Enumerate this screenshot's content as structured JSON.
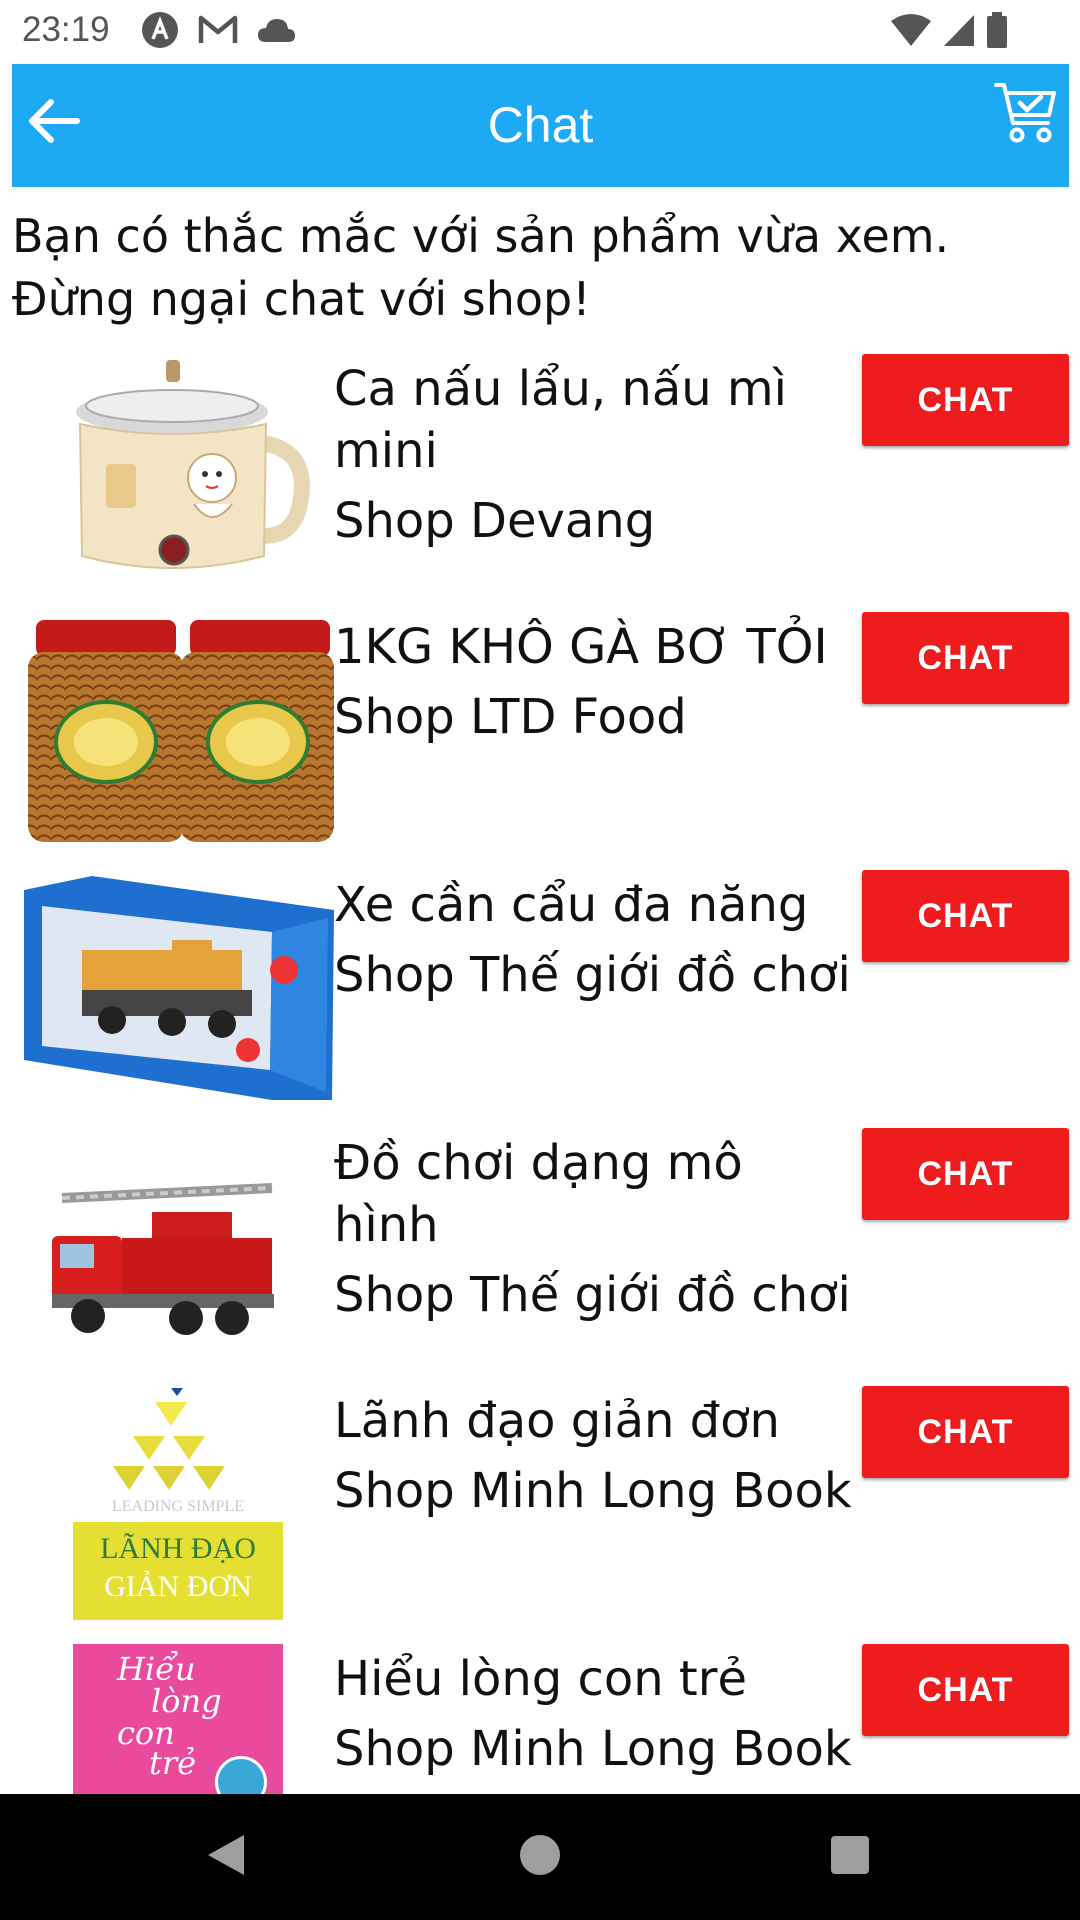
{
  "status_bar": {
    "time": "23:19",
    "left_icons": [
      "app-a-icon",
      "gmail-icon",
      "cloud-icon"
    ],
    "right_icons": [
      "wifi-icon",
      "cell-signal-icon",
      "battery-icon"
    ]
  },
  "app_bar": {
    "title": "Chat",
    "back_icon": "arrow-left-icon",
    "cart_icon": "shopping-cart-check-icon",
    "color": "#1ea9f5"
  },
  "intro": {
    "line1": "Bạn có thắc mắc với sản phẩm vừa xem.",
    "line2": "Đừng ngại chat với shop!"
  },
  "items": [
    {
      "name": "Ca nấu lẩu, nấu mì mini",
      "shop": "Shop Devang",
      "chat_label": "CHAT",
      "image": "mini-cooker-pot-image"
    },
    {
      "name": "1KG KHÔ GÀ BƠ TỎI",
      "shop": "Shop LTD Food",
      "chat_label": "CHAT",
      "image": "dried-chicken-jars-image"
    },
    {
      "name": "Xe cần cẩu đa năng",
      "shop": "Shop Thế giới đồ chơi",
      "chat_label": "CHAT",
      "image": "crane-truck-toy-box-image"
    },
    {
      "name": "Đồ chơi dạng mô hình",
      "shop": "Shop Thế giới đồ chơi",
      "chat_label": "CHAT",
      "image": "fire-truck-model-image"
    },
    {
      "name": "Lãnh đạo giản đơn",
      "shop": "Shop Minh Long Book",
      "chat_label": "CHAT",
      "image": "book-cover-leading-simple-image"
    },
    {
      "name": "Hiểu lòng con trẻ",
      "shop": "Shop Minh Long Book",
      "chat_label": "CHAT",
      "image": "book-cover-hieu-long-con-tre-image"
    }
  ],
  "book_cover_texts": {
    "leading_simple_en": "LEADING SIMPLE",
    "leading_simple_vi_1": "LÃNH ĐẠO",
    "leading_simple_vi_2": "GIẢN ĐƠN",
    "hieu_long_1": "Hiểu",
    "hieu_long_2": "lòng",
    "hieu_long_3": "con",
    "hieu_long_4": "trẻ"
  },
  "nav_bar": {
    "buttons": [
      "back-triangle-icon",
      "home-circle-icon",
      "recents-square-icon"
    ]
  },
  "colors": {
    "chat_button": "#ee1c1c",
    "nav_bar": "#000000"
  }
}
